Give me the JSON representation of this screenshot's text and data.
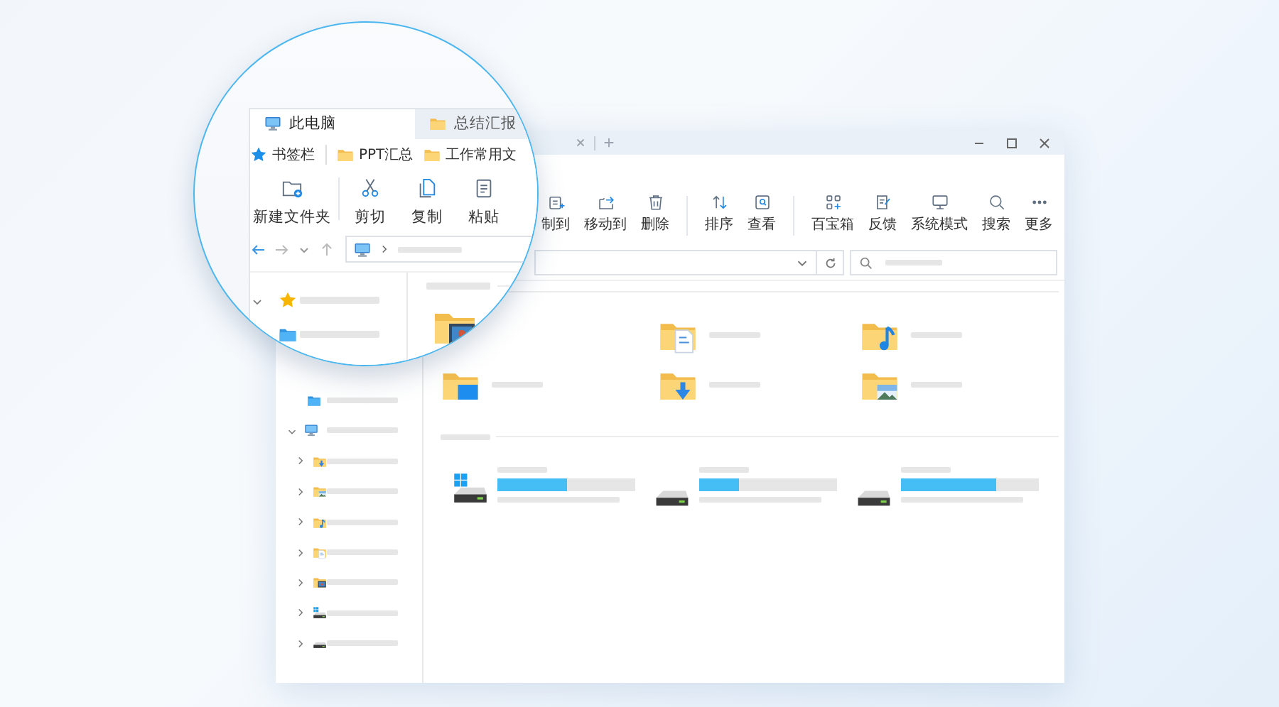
{
  "window": {
    "toolbar_groups": [
      [
        {
          "label": "制到",
          "kind": "copy-to"
        },
        {
          "label": "移动到",
          "kind": "move-to"
        },
        {
          "label": "删除",
          "kind": "delete"
        }
      ],
      [
        {
          "label": "排序",
          "kind": "sort"
        },
        {
          "label": "查看",
          "kind": "view"
        }
      ],
      [
        {
          "label": "百宝箱",
          "kind": "toolbox"
        },
        {
          "label": "反馈",
          "kind": "feedback"
        },
        {
          "label": "系统模式",
          "kind": "monitor"
        },
        {
          "label": "搜索",
          "kind": "search"
        },
        {
          "label": "更多",
          "kind": "more"
        }
      ]
    ],
    "sidebar": [
      {
        "kind": "folder-blue"
      },
      {
        "kind": "computer",
        "expanded": true,
        "children": [
          {
            "kind": "downloads",
            "expanded": false
          },
          {
            "kind": "pictures",
            "expanded": false
          },
          {
            "kind": "music",
            "expanded": false
          },
          {
            "kind": "documents",
            "expanded": false
          },
          {
            "kind": "videos",
            "expanded": false
          },
          {
            "kind": "system-drive",
            "expanded": false
          },
          {
            "kind": "drive",
            "expanded": false
          }
        ]
      }
    ],
    "folders": [
      {
        "kind": "documents"
      },
      {
        "kind": "music"
      },
      {
        "kind": "desktop"
      },
      {
        "kind": "downloads"
      },
      {
        "kind": "pictures"
      }
    ],
    "drives": [
      {
        "kind": "system-drive",
        "level": 0.5
      },
      {
        "kind": "drive",
        "level": 0.29
      },
      {
        "kind": "drive",
        "level": 0.69
      }
    ]
  },
  "magnifier": {
    "tabs": [
      {
        "label": "此电脑",
        "kind": "computer",
        "selected": true
      },
      {
        "label": "总结汇报",
        "kind": "folder",
        "selected": false
      }
    ],
    "bookmarks": [
      {
        "label": "书签栏",
        "kind": "star-blue"
      },
      {
        "label": "PPT汇总",
        "kind": "folder"
      },
      {
        "label": "工作常用文",
        "kind": "folder"
      }
    ],
    "toolbar_groups": [
      [
        {
          "label": "新建文件夹",
          "kind": "new-folder"
        }
      ],
      [
        {
          "label": "剪切",
          "kind": "cut"
        },
        {
          "label": "复制",
          "kind": "copy"
        },
        {
          "label": "粘贴",
          "kind": "paste"
        }
      ]
    ],
    "sidebar": [
      {
        "kind": "star",
        "expanded": true
      },
      {
        "kind": "folder-blue"
      }
    ],
    "folders": [
      {
        "kind": "videos"
      }
    ]
  }
}
